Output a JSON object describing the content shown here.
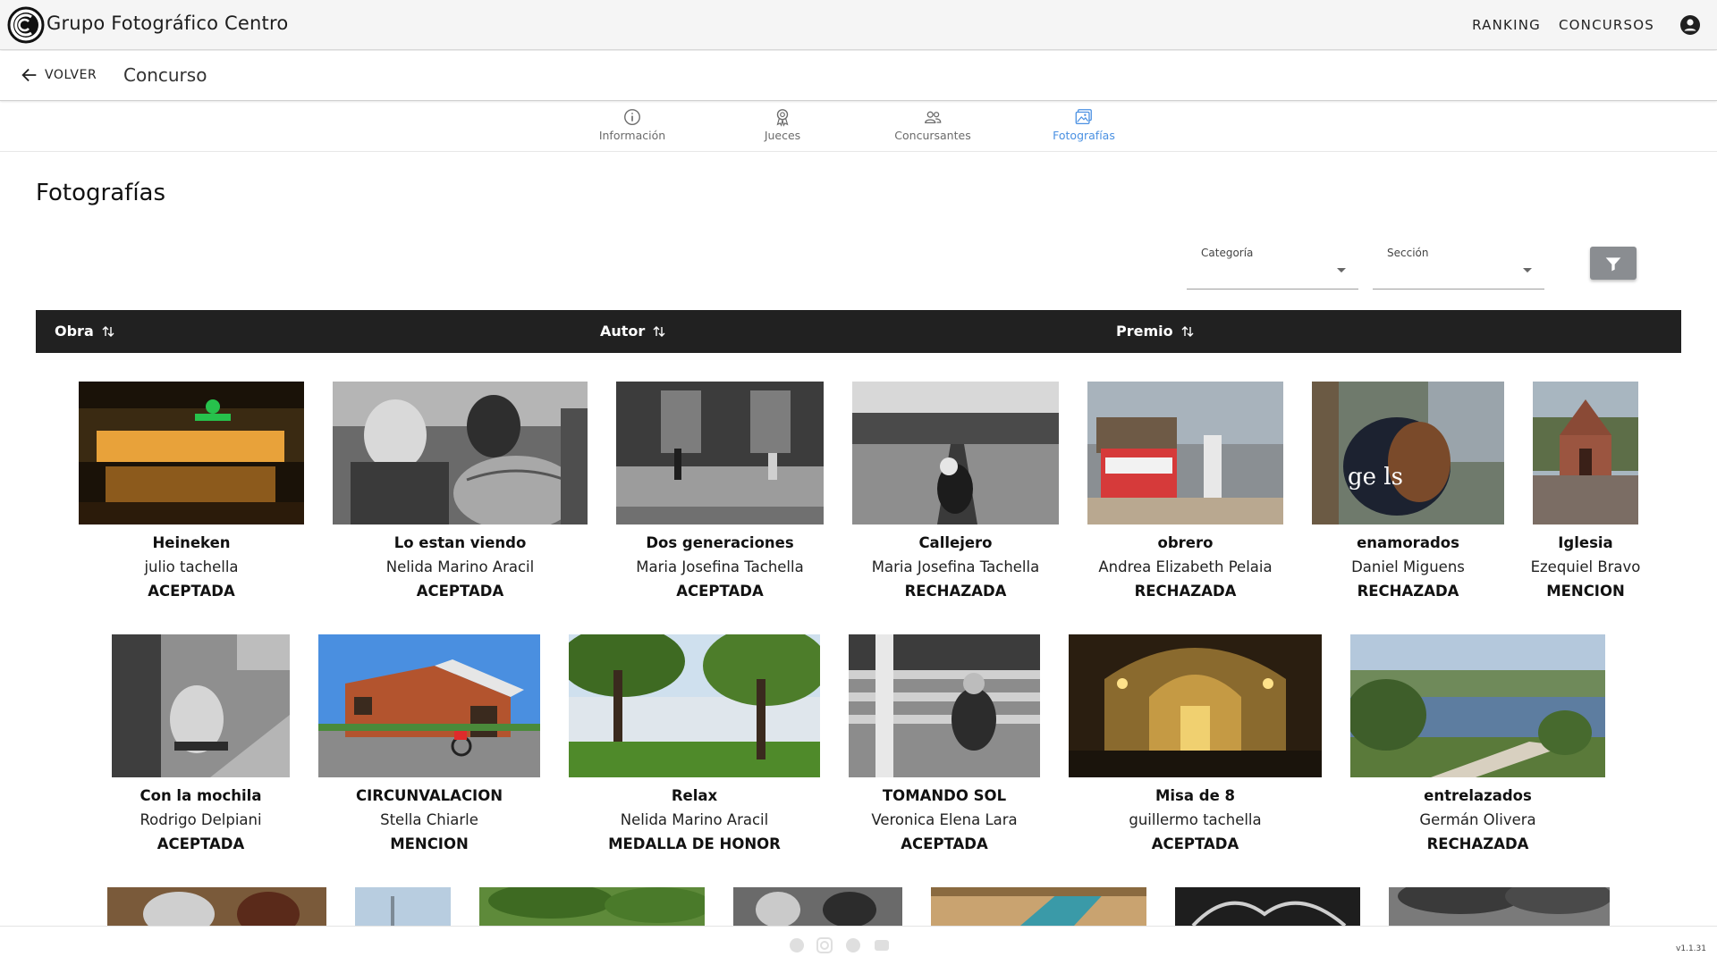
{
  "header": {
    "brand": "Grupo Fotográfico Centro",
    "nav": [
      {
        "label": "RANKING"
      },
      {
        "label": "CONCURSOS"
      }
    ]
  },
  "subbar": {
    "back_label": "VOLVER",
    "title": "Concurso"
  },
  "tabs": [
    {
      "label": "Información",
      "icon": "info-icon",
      "active": false
    },
    {
      "label": "Jueces",
      "icon": "award-icon",
      "active": false
    },
    {
      "label": "Concursantes",
      "icon": "users-icon",
      "active": false
    },
    {
      "label": "Fotografías",
      "icon": "image-icon",
      "active": true
    }
  ],
  "main": {
    "title": "Fotografías",
    "filters": {
      "categoria_label": "Categoría",
      "seccion_label": "Sección"
    },
    "table_headers": [
      {
        "label": "Obra"
      },
      {
        "label": "Autor"
      },
      {
        "label": "Premio"
      }
    ],
    "photos_row1": [
      {
        "title": "Heineken",
        "author": "julio tachella",
        "award": "ACEPTADA"
      },
      {
        "title": "Lo estan viendo",
        "author": "Nelida Marino Aracil",
        "award": "ACEPTADA"
      },
      {
        "title": "Dos generaciones",
        "author": "Maria Josefina Tachella",
        "award": "ACEPTADA"
      },
      {
        "title": "Callejero",
        "author": "Maria Josefina Tachella",
        "award": "RECHAZADA"
      },
      {
        "title": "obrero",
        "author": "Andrea Elizabeth Pelaia",
        "award": "RECHAZADA"
      },
      {
        "title": "enamorados",
        "author": "Daniel Miguens",
        "award": "RECHAZADA"
      },
      {
        "title": "Iglesia",
        "author": "Ezequiel Bravo",
        "award": "MENCION"
      }
    ],
    "photos_row2": [
      {
        "title": "Con la mochila",
        "author": "Rodrigo Delpiani",
        "award": "ACEPTADA"
      },
      {
        "title": "CIRCUNVALACION",
        "author": "Stella Chiarle",
        "award": "MENCION"
      },
      {
        "title": "Relax",
        "author": "Nelida Marino Aracil",
        "award": "MEDALLA DE HONOR"
      },
      {
        "title": "TOMANDO SOL",
        "author": "Veronica Elena Lara",
        "award": "ACEPTADA"
      },
      {
        "title": "Misa de 8",
        "author": "guillermo tachella",
        "award": "ACEPTADA"
      },
      {
        "title": "entrelazados",
        "author": "Germán Olivera",
        "award": "RECHAZADA"
      }
    ],
    "photo_image_embedded_text": "ge ls"
  },
  "footer": {
    "version": "v1.1.31",
    "social_icons": [
      "whatsapp-icon",
      "instagram-icon",
      "facebook-icon",
      "youtube-icon"
    ]
  },
  "colors": {
    "accent": "#4a90e2",
    "table_header_bg": "#212121",
    "filter_button": "#8a8d91"
  }
}
